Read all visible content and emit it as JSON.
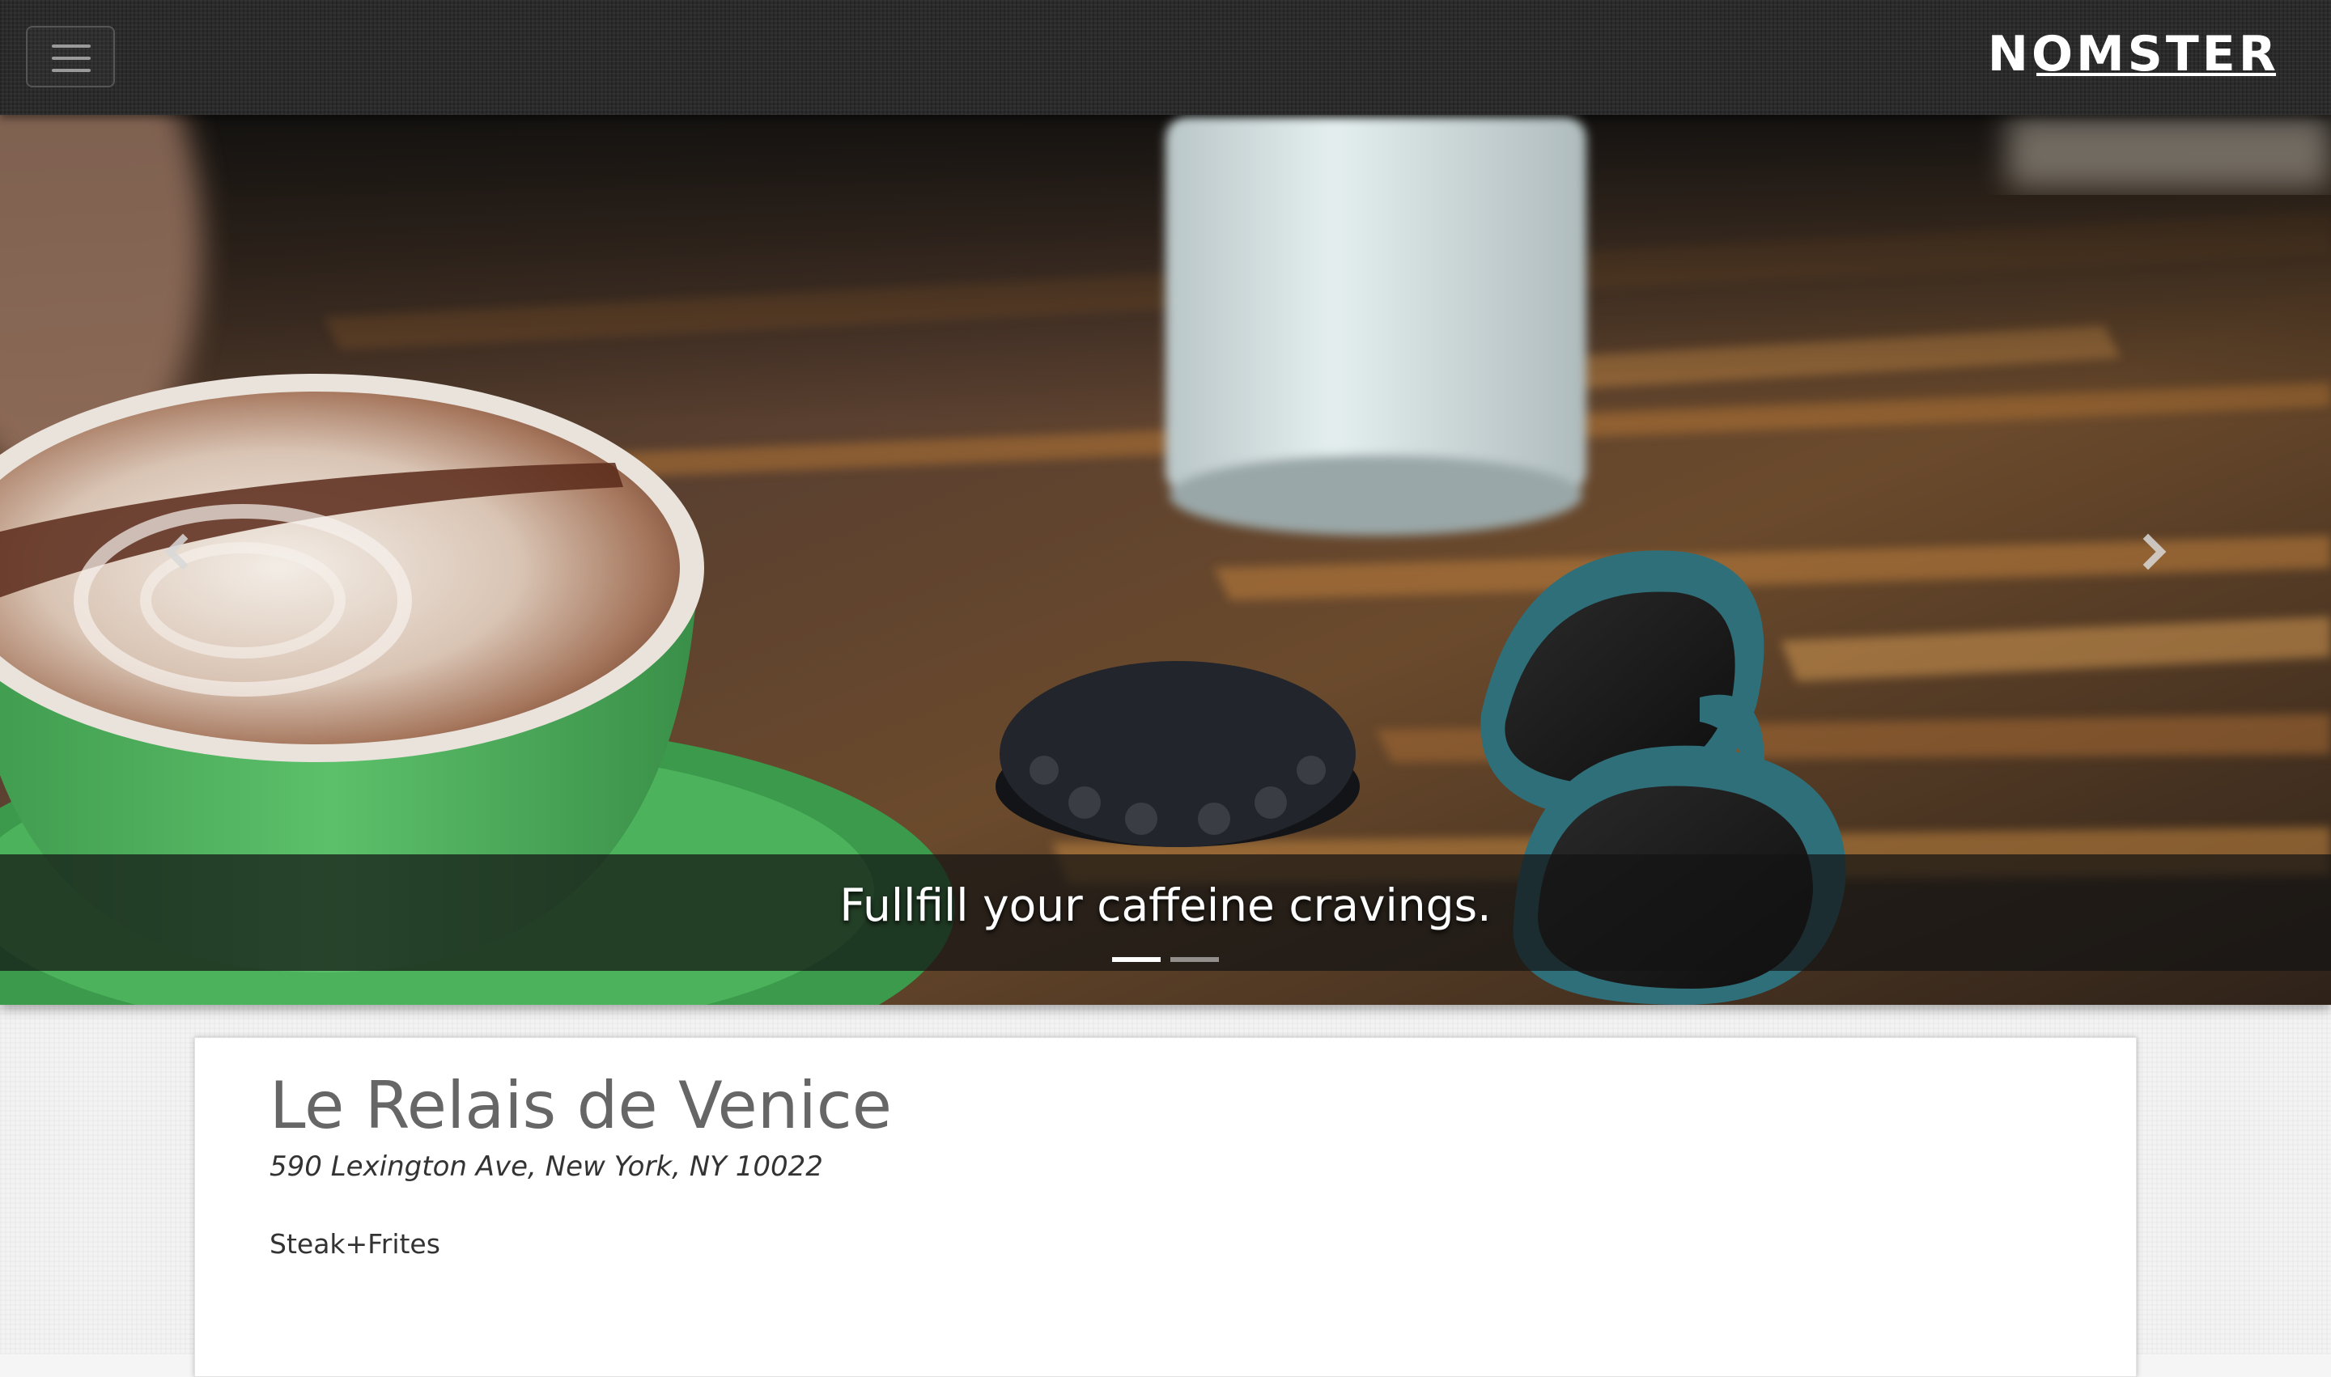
{
  "navbar": {
    "toggle_icon": "hamburger-menu-icon",
    "brand": "NOMSTER"
  },
  "carousel": {
    "caption": "Fullfill your caffeine cravings.",
    "slide_count": 2,
    "active_slide": 1,
    "prev_icon": "chevron-left-icon",
    "next_icon": "chevron-right-icon"
  },
  "place": {
    "name": "Le Relais de Venice",
    "address": "590 Lexington Ave, New York, NY 10022",
    "description": "Steak+Frites"
  },
  "colors": {
    "navbar_bg": "#2b2b2b",
    "page_bg": "#f3f3f3",
    "title_text": "#666666",
    "body_text": "#333333",
    "caption_band": "#141414"
  }
}
